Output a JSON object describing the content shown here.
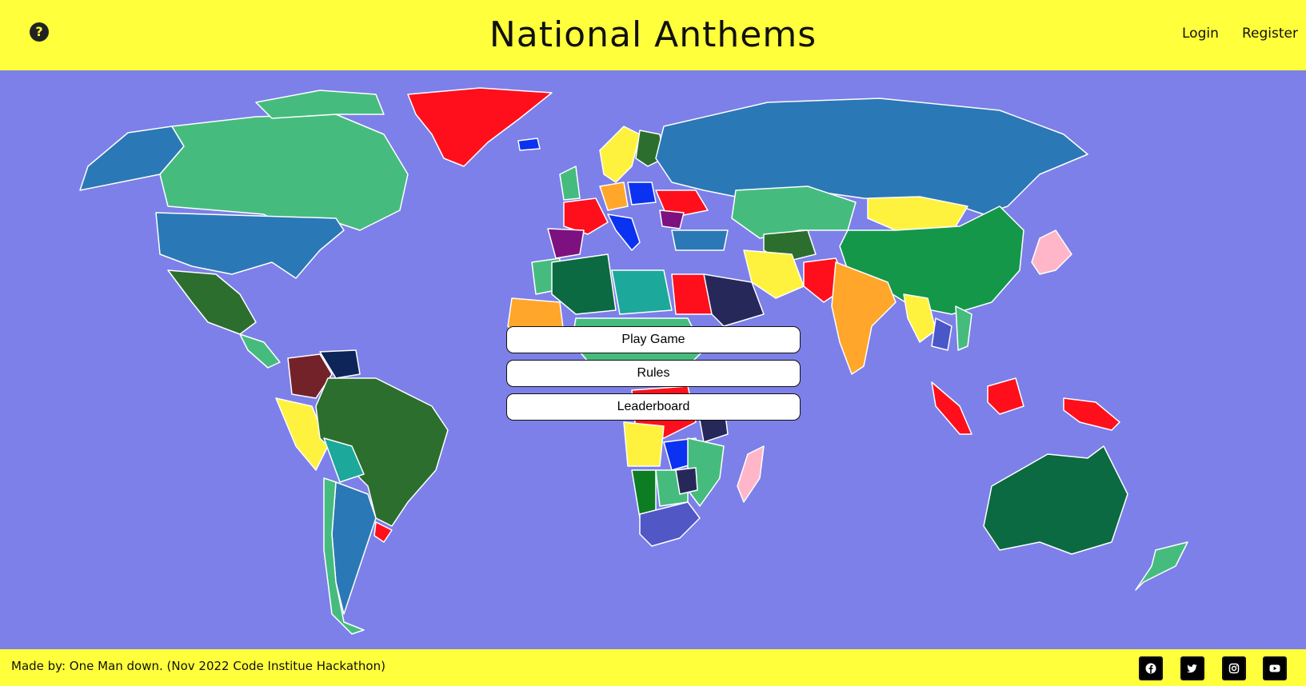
{
  "header": {
    "title": "National Anthems",
    "help_icon": "question-circle-icon",
    "nav": {
      "login": "Login",
      "register": "Register"
    }
  },
  "menu": {
    "play": "Play Game",
    "rules": "Rules",
    "leaderboard": "Leaderboard"
  },
  "footer": {
    "credit": "Made by: One Man down. (Nov 2022 Code Institue Hackathon)",
    "social_icons": [
      "facebook-icon",
      "twitter-icon",
      "instagram-icon",
      "youtube-icon"
    ]
  },
  "colors": {
    "banner": "#ffff3b",
    "ocean": "#7c80e8"
  }
}
